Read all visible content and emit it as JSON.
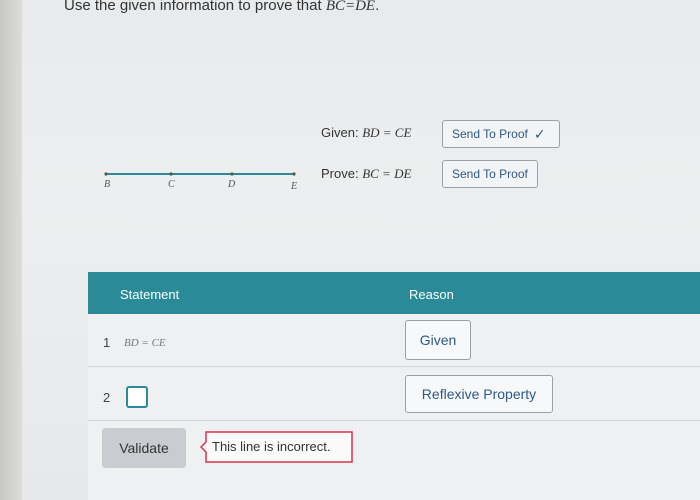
{
  "instruction": {
    "prefix": "Use the given information to prove that ",
    "math": "BC=DE",
    "suffix": "."
  },
  "given": {
    "label": "Given: ",
    "math": "BD = CE",
    "button_label": "Send To Proof",
    "sent": true
  },
  "prove": {
    "label": "Prove: ",
    "math": "BC = DE",
    "button_label": "Send To Proof"
  },
  "diagram": {
    "points": [
      "B",
      "C",
      "D",
      "E"
    ],
    "line_color": "#2a8a98"
  },
  "table": {
    "headers": {
      "statement": "Statement",
      "reason": "Reason"
    },
    "rows": [
      {
        "number": "1",
        "statement": "BD = CE",
        "reason": "Given"
      },
      {
        "number": "2",
        "statement": "",
        "reason": "Reflexive Property"
      }
    ]
  },
  "validate": {
    "label": "Validate",
    "error": "This line is incorrect."
  },
  "colors": {
    "accent": "#2a8a98",
    "error": "#d9324a",
    "link": "#2d5a87"
  }
}
